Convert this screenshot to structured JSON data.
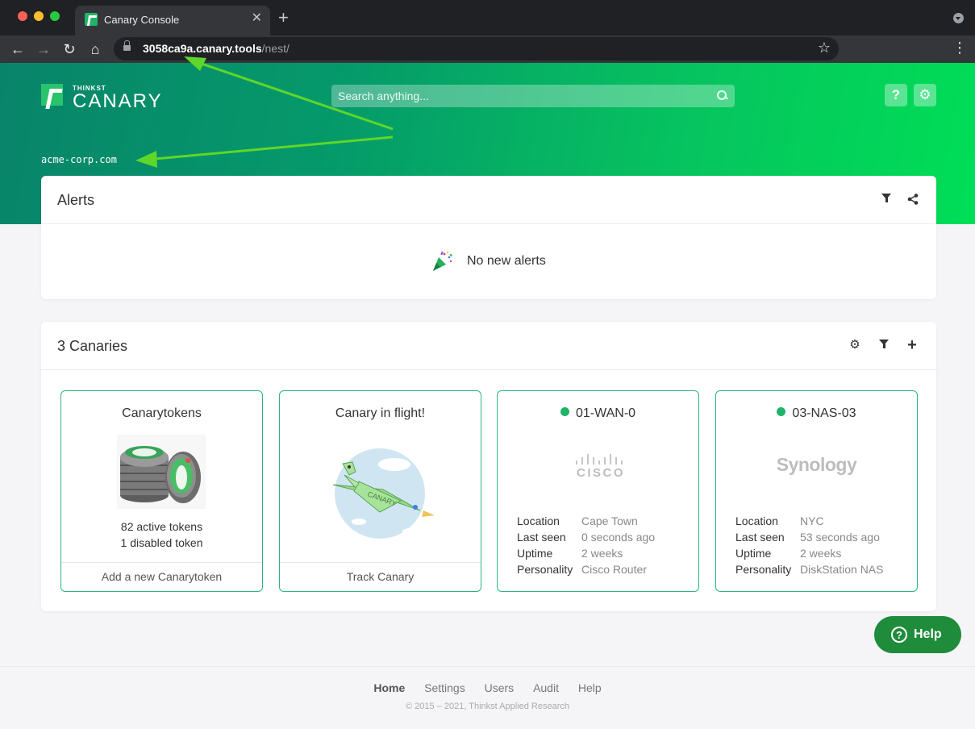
{
  "browser": {
    "tab_title": "Canary Console",
    "tab_close": "✕",
    "new_tab": "+",
    "url_host": "3058ca9a.canary.tools",
    "url_path": "/nest/"
  },
  "header": {
    "logo_small": "THINKST",
    "logo_big": "CANARY",
    "search_placeholder": "Search anything...",
    "help_label": "?",
    "domain": "acme-corp.com"
  },
  "alerts": {
    "title": "Alerts",
    "empty_text": "No new alerts"
  },
  "canaries": {
    "title": "3 Canaries",
    "tiles": [
      {
        "title": "Canarytokens",
        "line1": "82 active tokens",
        "line2": "1 disabled token",
        "footer": "Add a new Canarytoken"
      },
      {
        "title": "Canary in flight!",
        "footer": "Track Canary"
      },
      {
        "title": "01-WAN-0",
        "status_color": "#1fb467",
        "logo": "CISCO",
        "info": [
          {
            "key": "Location",
            "value": "Cape Town"
          },
          {
            "key": "Last seen",
            "value": "0 seconds ago"
          },
          {
            "key": "Uptime",
            "value": "2 weeks"
          },
          {
            "key": "Personality",
            "value": "Cisco Router"
          }
        ]
      },
      {
        "title": "03-NAS-03",
        "status_color": "#1fb467",
        "logo": "Synology",
        "info": [
          {
            "key": "Location",
            "value": "NYC"
          },
          {
            "key": "Last seen",
            "value": "53 seconds ago"
          },
          {
            "key": "Uptime",
            "value": "2 weeks"
          },
          {
            "key": "Personality",
            "value": "DiskStation NAS"
          }
        ]
      }
    ]
  },
  "footer": {
    "links": [
      "Home",
      "Settings",
      "Users",
      "Audit",
      "Help"
    ],
    "copyright": "© 2015 – 2021, Thinkst Applied Research"
  },
  "help_fab": {
    "icon": "?",
    "label": "Help"
  },
  "colors": {
    "accent": "#1fb467",
    "tile_border": "#29b77e",
    "help_fab": "#1f8c3c",
    "annotation_arrow": "#5ed62a"
  }
}
